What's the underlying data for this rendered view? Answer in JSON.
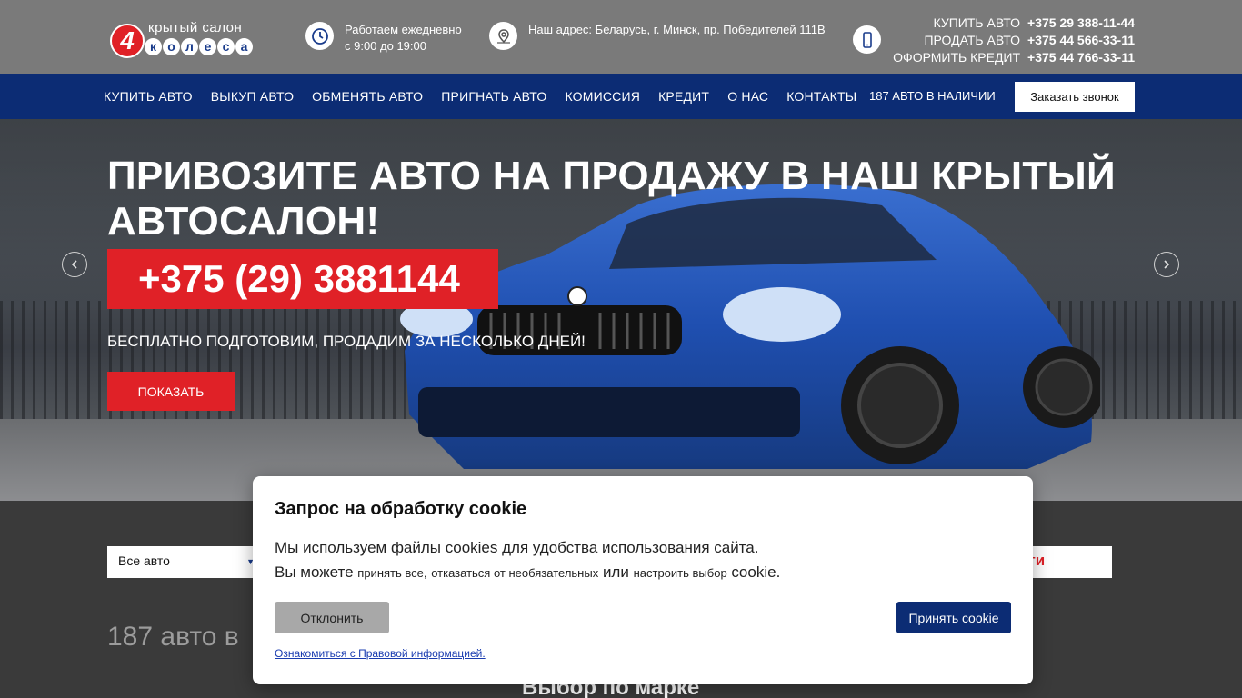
{
  "logo": {
    "digit": "4",
    "top_text": "крытый салон",
    "letters": [
      "к",
      "о",
      "л",
      "е",
      "с",
      "а"
    ]
  },
  "header": {
    "hours": {
      "line1": "Работаем ежедневно",
      "line2": "с 9:00 до 19:00",
      "icon": "clock-icon"
    },
    "address": {
      "text": "Наш адрес: Беларусь, г. Минск, пр. Победителей 111В",
      "icon": "map-pin-icon"
    },
    "phone_icon": "smartphone-icon",
    "contacts": [
      {
        "label": "КУПИТЬ АВТО",
        "number": "+375 29 388-11-44"
      },
      {
        "label": "ПРОДАТЬ АВТО",
        "number": "+375 44 566-33-11"
      },
      {
        "label": "ОФОРМИТЬ КРЕДИТ",
        "number": "+375 44 766-33-11"
      }
    ]
  },
  "nav": {
    "items": [
      "КУПИТЬ АВТО",
      "ВЫКУП АВТО",
      "ОБМЕНЯТЬ АВТО",
      "ПРИГНАТЬ АВТО",
      "КОМИССИЯ",
      "КРЕДИТ",
      "О НАС",
      "КОНТАКТЫ"
    ],
    "count": "187 АВТО В НАЛИЧИИ",
    "callback": "Заказать звонок"
  },
  "hero": {
    "title": "ПРИВОЗИТЕ АВТО НА ПРОДАЖУ В НАШ КРЫТЫЙ АВТОСАЛОН!",
    "phone": "+375 (29) 3881144",
    "subtitle": "БЕСПЛАТНО ПОДГОТОВИМ, ПРОДАДИМ ЗА НЕСКОЛЬКО ДНЕЙ!",
    "button": "ПОКАЗАТЬ"
  },
  "filter": {
    "select_value": "Все авто",
    "find_partial": "йти"
  },
  "stock_count_partial": "187 авто в",
  "brand_section_title": "Выбор по марке",
  "cookie": {
    "title": "Запрос на обработку cookie",
    "line1": "Мы используем файлы cookies для удобства использования сайта.",
    "line2_a": "Вы можете",
    "line2_b": "принять все,",
    "line2_c": "отказаться от необязательных",
    "line2_d": "или",
    "line2_e": "настроить выбор",
    "line2_f": "cookie.",
    "decline": "Отклонить",
    "accept": "Принять cookie",
    "legal": "Ознакомиться с Правовой информацией."
  },
  "colors": {
    "brand_red": "#e02127",
    "nav_blue": "#0c2c74",
    "header_gray": "#7a7a7a"
  }
}
